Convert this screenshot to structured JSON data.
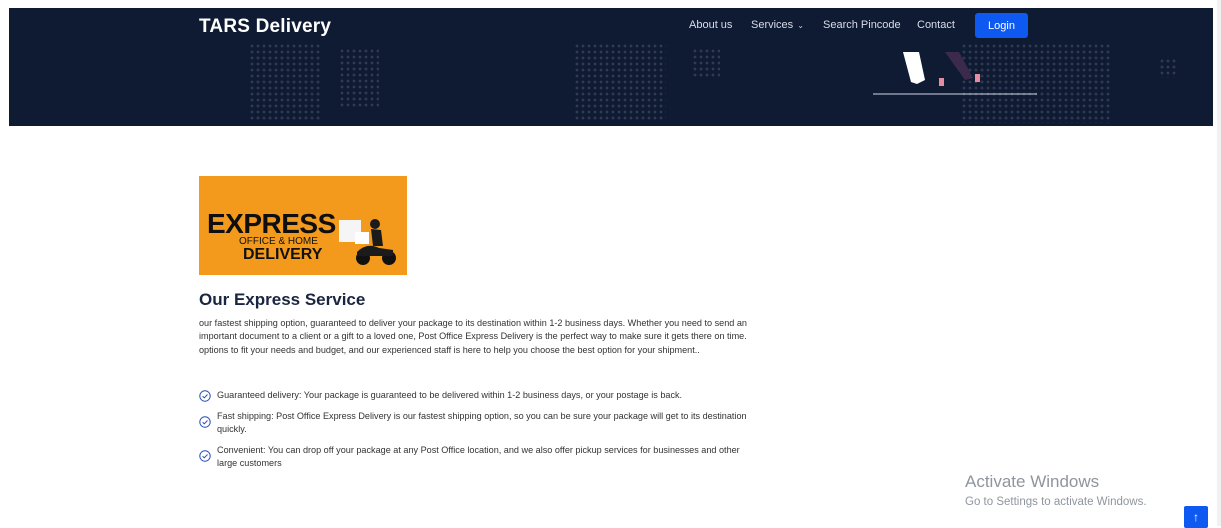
{
  "header": {
    "brand": "TARS Delivery",
    "nav": {
      "about": "About us",
      "services": "Services",
      "search_pincode": "Search Pincode",
      "contact": "Contact",
      "login": "Login"
    }
  },
  "content": {
    "image": {
      "line1": "EXPRESS",
      "line2": "OFFICE & HOME",
      "line3": "DELIVERY"
    },
    "title": "Our Express Service",
    "description": "our fastest shipping option, guaranteed to deliver your package to its destination within 1-2 business days. Whether you need to send an important document to a client or a gift to a loved one, Post Office Express Delivery is the perfect way to make sure it gets there on time. options to fit your needs and budget, and our experienced staff is here to help you choose the best option for your shipment..",
    "features": [
      "Guaranteed delivery: Your package is guaranteed to be delivered within 1-2 business days, or your postage is back.",
      "Fast shipping: Post Office Express Delivery is our fastest shipping option, so you can be sure your package will get to its destination quickly.",
      "Convenient: You can drop off your package at any Post Office location, and we also offer pickup services for businesses and other large customers"
    ]
  },
  "watermark": {
    "title": "Activate Windows",
    "subtitle": "Go to Settings to activate Windows."
  },
  "scroll_top": {
    "label": "↑"
  },
  "icons": {
    "check": "check-circle-icon",
    "caret": "chevron-down-icon"
  },
  "colors": {
    "header_bg": "#0f1a33",
    "accent": "#0d59f2",
    "image_bg": "#f39a1c",
    "title": "#1a2540"
  }
}
